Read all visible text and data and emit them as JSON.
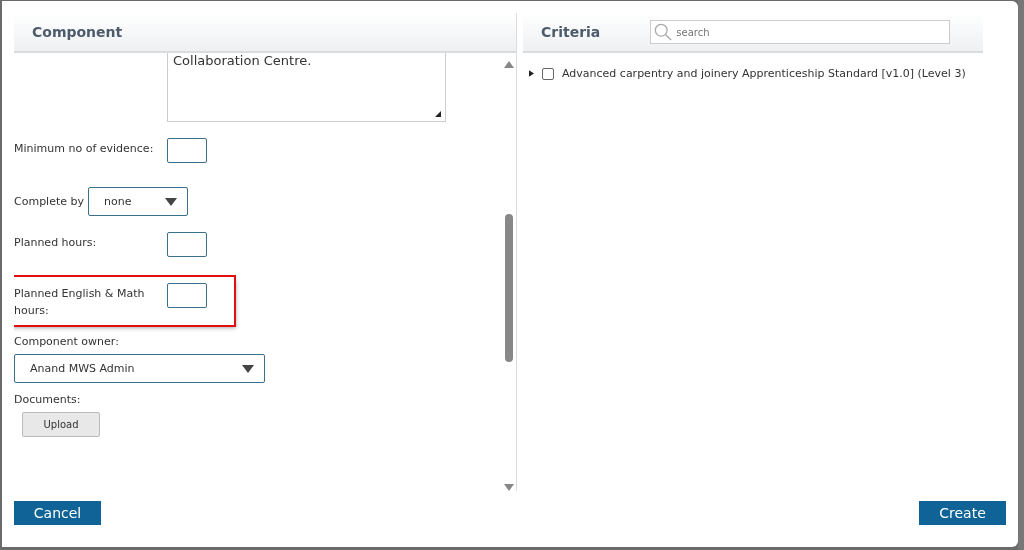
{
  "component": {
    "title": "Component",
    "description": "Collaboration Centre.",
    "fields": [
      {
        "kind": "input",
        "label": "Minimum no of evidence:",
        "highlighted": false
      },
      {
        "kind": "select",
        "label": "Complete by",
        "value": "none",
        "highlighted": false
      },
      {
        "kind": "input",
        "label": "Planned hours:",
        "highlighted": false
      },
      {
        "kind": "input",
        "label": "Planned English & Math hours:",
        "highlighted": true
      },
      {
        "kind": "wide-select",
        "label": "Component owner:",
        "value": "Anand MWS Admin",
        "highlighted": false
      },
      {
        "kind": "upload",
        "label": "Documents:",
        "button": "Upload",
        "highlighted": false
      }
    ]
  },
  "criteria": {
    "title": "Criteria",
    "search": {
      "placeholder": "search"
    },
    "items": [
      {
        "label": "Advanced carpentry and joinery Apprenticeship Standard [v1.0] (Level 3)",
        "checked": false,
        "expanded": false
      }
    ]
  },
  "buttons": {
    "cancel": "Cancel",
    "create": "Create"
  }
}
